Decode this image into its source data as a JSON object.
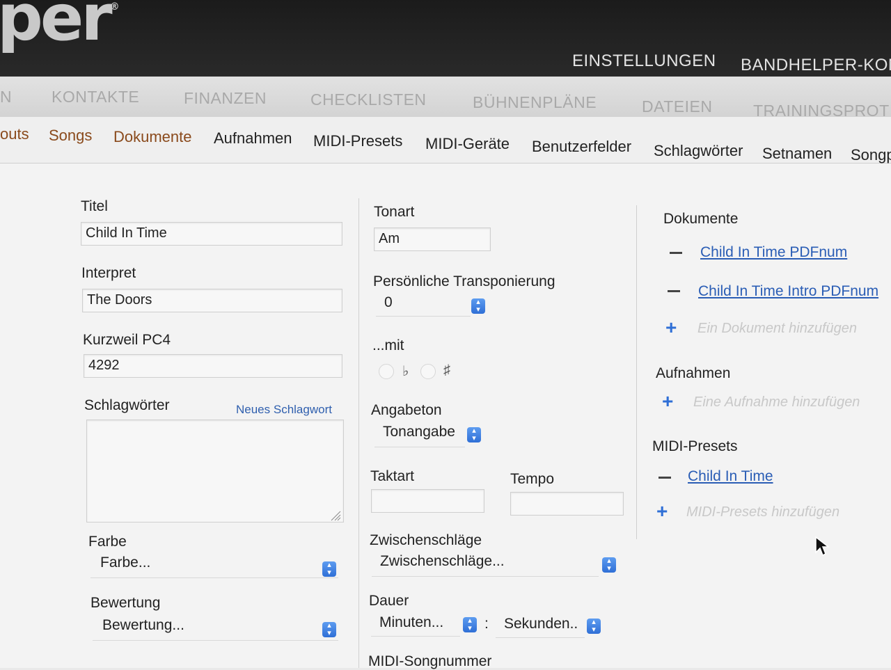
{
  "brand": {
    "logo_text": "per",
    "logo_mark": "®"
  },
  "top_nav": {
    "settings": "EINSTELLUNGEN",
    "account": "BANDHELPER-KON"
  },
  "category_nav": [
    "N",
    "KONTAKTE",
    "FINANZEN",
    "CHECKLISTEN",
    "BÜHNENPLÄNE",
    "DATEIEN",
    "TRAININGSPROT"
  ],
  "sub_nav": {
    "items": [
      "outs",
      "Songs",
      "Dokumente",
      "Aufnahmen",
      "MIDI-Presets",
      "MIDI-Geräte",
      "Benutzerfelder",
      "Schlagwörter",
      "Setnamen",
      "Songp"
    ],
    "active": "Songs"
  },
  "form": {
    "title": {
      "label": "Titel",
      "value": "Child In Time"
    },
    "artist": {
      "label": "Interpret",
      "value": "The Doors"
    },
    "kurzweil": {
      "label": "Kurzweil PC4",
      "value": "4292"
    },
    "tags": {
      "label": "Schlagwörter",
      "new_tag_link": "Neues Schlagwort",
      "value": ""
    },
    "color": {
      "label": "Farbe",
      "selected": "Farbe..."
    },
    "rating": {
      "label": "Bewertung",
      "selected": "Bewertung..."
    },
    "key": {
      "label": "Tonart",
      "value": "Am"
    },
    "transpose": {
      "label": "Persönliche Transponierung",
      "selected": "0"
    },
    "with": {
      "label": "...mit",
      "flat": "♭",
      "sharp": "♯"
    },
    "pitch": {
      "label": "Angabeton",
      "selected": "Tonangabe"
    },
    "time_signature": {
      "label": "Taktart",
      "value": ""
    },
    "tempo": {
      "label": "Tempo",
      "value": ""
    },
    "interludes": {
      "label": "Zwischenschläge",
      "selected": "Zwischenschläge..."
    },
    "duration": {
      "label": "Dauer",
      "minutes": "Minuten...",
      "separator": ":",
      "seconds": "Sekunden.."
    },
    "midi_song_number": {
      "label": "MIDI-Songnummer"
    }
  },
  "sidebar": {
    "documents": {
      "heading": "Dokumente",
      "items": [
        "Child In Time PDFnum",
        "Child In Time Intro PDFnum"
      ],
      "add_placeholder": "Ein Dokument hinzufügen"
    },
    "recordings": {
      "heading": "Aufnahmen",
      "add_placeholder": "Eine Aufnahme hinzufügen"
    },
    "midi_presets": {
      "heading": "MIDI-Presets",
      "items": [
        "Child In Time"
      ],
      "add_placeholder": "MIDI-Presets hinzufügen"
    }
  },
  "colors": {
    "accent": "#2f6fd6",
    "link": "#2a5db5",
    "active_tab": "#8a4a1c",
    "topbar": "#1f1f1f"
  }
}
